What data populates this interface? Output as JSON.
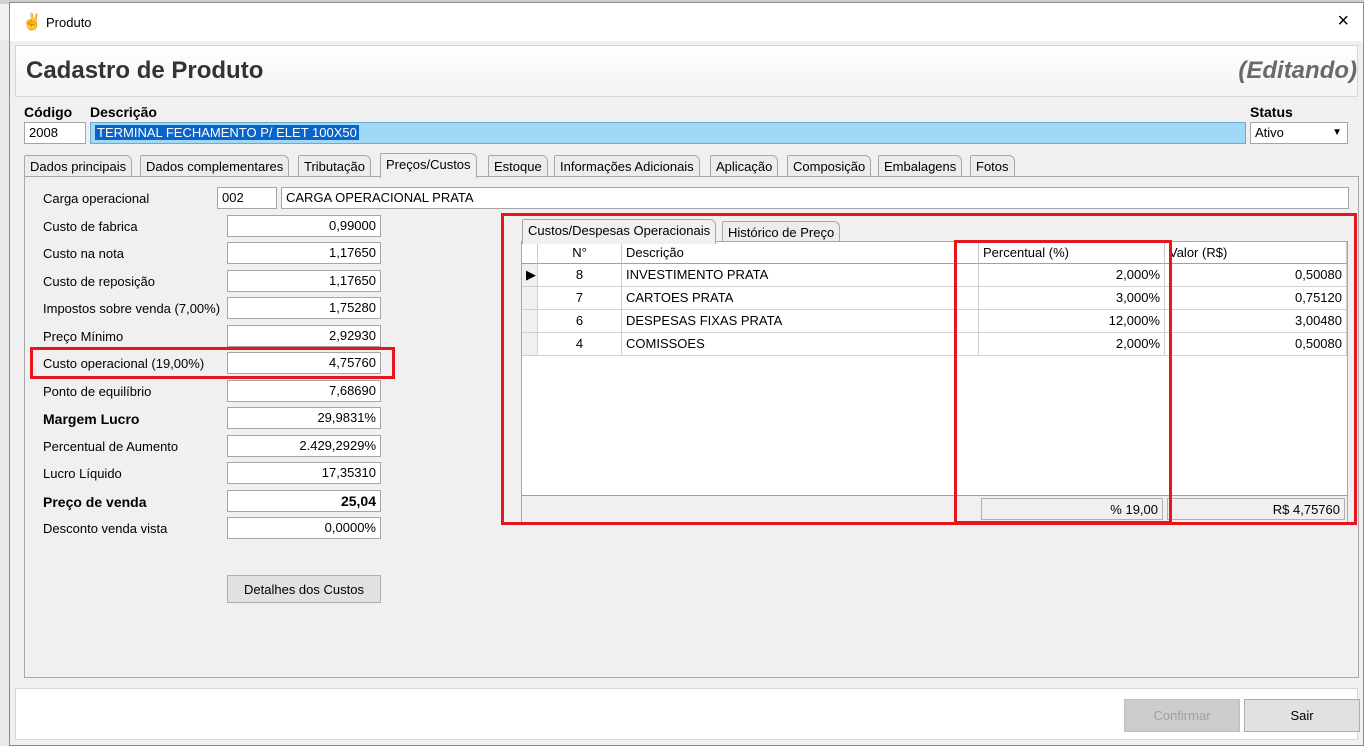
{
  "window": {
    "title": "Produto",
    "close_icon": "×"
  },
  "header": {
    "title": "Cadastro de Produto",
    "mode": "(Editando)"
  },
  "product": {
    "codigo_label": "Código",
    "codigo": "2008",
    "descricao_label": "Descrição",
    "descricao": "TERMINAL FECHAMENTO P/ ELET 100X50",
    "status_label": "Status",
    "status": "Ativo"
  },
  "tabs": [
    {
      "label": "Dados principais"
    },
    {
      "label": "Dados complementares"
    },
    {
      "label": "Tributação"
    },
    {
      "label": "Preços/Custos"
    },
    {
      "label": "Estoque"
    },
    {
      "label": "Informações Adicionais"
    },
    {
      "label": "Aplicação"
    },
    {
      "label": "Composição"
    },
    {
      "label": "Embalagens"
    },
    {
      "label": "Fotos"
    }
  ],
  "precos": {
    "carga_label": "Carga operacional",
    "carga_code": "002",
    "carga_desc": "CARGA OPERACIONAL PRATA",
    "rows": [
      {
        "label": "Custo de fabrica",
        "value": "0,99000"
      },
      {
        "label": "Custo na nota",
        "value": "1,17650"
      },
      {
        "label": "Custo de reposição",
        "value": "1,17650"
      },
      {
        "label": "Impostos sobre venda (7,00%)",
        "value": "1,75280"
      },
      {
        "label": "Preço Mínimo",
        "value": "2,92930"
      },
      {
        "label": "Custo operacional (19,00%)",
        "value": "4,75760"
      },
      {
        "label": "Ponto de equilíbrio",
        "value": "7,68690"
      },
      {
        "label": "Margem Lucro",
        "value": "29,9831%"
      },
      {
        "label": "Percentual de Aumento",
        "value": "2.429,2929%"
      },
      {
        "label": "Lucro Líquido",
        "value": "17,35310"
      },
      {
        "label": "Preço de venda",
        "value": "25,04"
      },
      {
        "label": "Desconto venda vista",
        "value": "0,0000%"
      }
    ],
    "detalhes_button": "Detalhes dos Custos"
  },
  "inner_tabs": [
    {
      "label": "Custos/Despesas Operacionais"
    },
    {
      "label": "Histórico de Preço"
    }
  ],
  "grid": {
    "headers": {
      "num": "N°",
      "descricao": "Descrição",
      "percentual": "Percentual (%)",
      "valor": "Valor (R$)"
    },
    "rows": [
      {
        "num": "8",
        "descricao": "INVESTIMENTO PRATA",
        "percentual": "2,000%",
        "valor": "0,50080"
      },
      {
        "num": "7",
        "descricao": "CARTOES PRATA",
        "percentual": "3,000%",
        "valor": "0,75120"
      },
      {
        "num": "6",
        "descricao": "DESPESAS FIXAS PRATA",
        "percentual": "12,000%",
        "valor": "3,00480"
      },
      {
        "num": "4",
        "descricao": "COMISSOES",
        "percentual": "2,000%",
        "valor": "0,50080"
      }
    ],
    "total_percentual": "% 19,00",
    "total_valor": "R$ 4,75760"
  },
  "buttons": {
    "confirmar": "Confirmar",
    "sair": "Sair"
  }
}
